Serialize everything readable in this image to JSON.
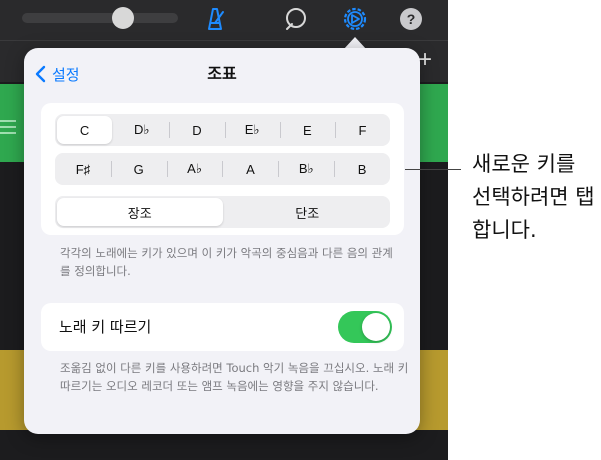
{
  "popover": {
    "back_label": "설정",
    "title": "조표",
    "keys_row1": [
      "C",
      "D♭",
      "D",
      "E♭",
      "E",
      "F"
    ],
    "keys_row2": [
      "F♯",
      "G",
      "A♭",
      "A",
      "B♭",
      "B"
    ],
    "selected_key": "C",
    "modes": [
      "장조",
      "단조"
    ],
    "selected_mode": "장조",
    "key_description": "각각의 노래에는 키가 있으며 이 키가 악곡의 중심음과 다른 음의 관계를 정의합니다.",
    "follow_song_key_label": "노래 키 따르기",
    "follow_song_key_on": true,
    "follow_description": "조옮김 없이 다른 키를 사용하려면 Touch 악기 녹음을 끄십시오. 노래 키 따르기는 오디오 레코더 또는 앰프 녹음에는 영향을 주지 않습니다."
  },
  "callout": {
    "text": "새로운 키를 선택하려면 탭합니다."
  },
  "colors": {
    "accent": "#0a7aff",
    "toggle_on": "#34c759",
    "track_green": "#2fa84f",
    "track_gold": "#b79a2e"
  },
  "icons": {
    "toolbar": [
      "metronome-icon",
      "loop-icon",
      "settings-gear-icon",
      "help-icon"
    ]
  }
}
